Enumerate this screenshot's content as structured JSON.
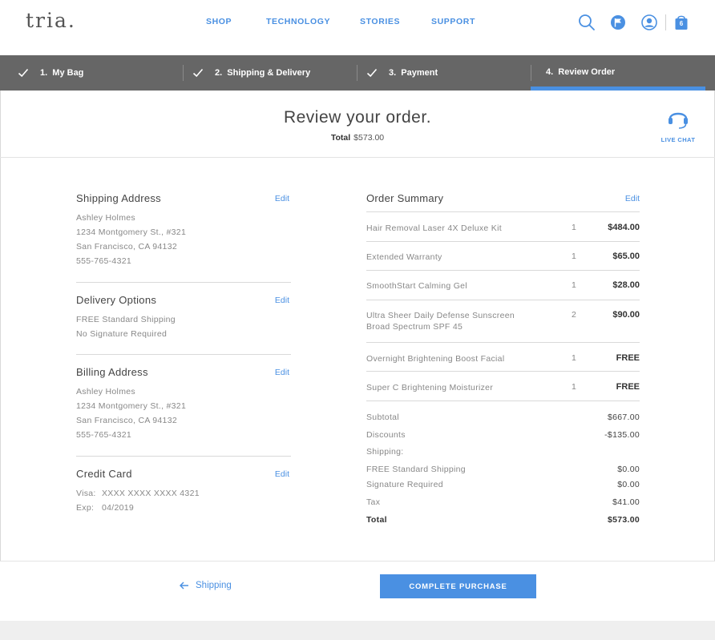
{
  "brand": {
    "logo": "tria",
    "logo_dot": "."
  },
  "nav": {
    "items": [
      "SHOP",
      "TECHNOLOGY",
      "STORIES",
      "SUPPORT"
    ]
  },
  "header": {
    "cart_count": "6"
  },
  "steps": [
    {
      "label": "1.  My Bag",
      "done": true
    },
    {
      "label": "2.  Shipping & Delivery",
      "done": true
    },
    {
      "label": "3.  Payment",
      "done": true
    },
    {
      "label": "4.  Review Order",
      "done": false,
      "active": true
    }
  ],
  "title": {
    "heading": "Review your order.",
    "total_label": "Total",
    "total_value": "$573.00"
  },
  "live_chat": {
    "label": "LIVE CHAT"
  },
  "shipping_address": {
    "title": "Shipping Address",
    "edit": "Edit",
    "lines": [
      "Ashley Holmes",
      "1234 Montgomery St., #321",
      "San Francisco, CA 94132",
      "555-765-4321"
    ]
  },
  "delivery_options": {
    "title": "Delivery Options",
    "edit": "Edit",
    "lines": [
      "FREE Standard Shipping",
      "No Signature Required"
    ]
  },
  "billing_address": {
    "title": "Billing Address",
    "edit": "Edit",
    "lines": [
      "Ashley Holmes",
      "1234 Montgomery St., #321",
      "San Francisco, CA 94132",
      "555-765-4321"
    ]
  },
  "credit_card": {
    "title": "Credit Card",
    "edit": "Edit",
    "visa_label": "Visa:",
    "visa_value": "XXXX XXXX XXXX 4321",
    "exp_label": "Exp:",
    "exp_value": "04/2019"
  },
  "order_summary": {
    "title": "Order Summary",
    "edit": "Edit",
    "items": [
      {
        "name": "Hair Removal Laser 4X Deluxe Kit",
        "qty": "1",
        "price": "$484.00"
      },
      {
        "name": "Extended Warranty",
        "qty": "1",
        "price": "$65.00"
      },
      {
        "name": "SmoothStart Calming Gel",
        "qty": "1",
        "price": "$28.00"
      },
      {
        "name": "Ultra Sheer Daily Defense Sunscreen",
        "name2": "Broad Spectrum SPF 45",
        "qty": "2",
        "price": "$90.00"
      },
      {
        "name": "Overnight Brightening Boost Facial",
        "qty": "1",
        "price": "FREE"
      },
      {
        "name": "Super C Brightening Moisturizer",
        "qty": "1",
        "price": "FREE"
      }
    ],
    "totals": [
      {
        "label": "Subtotal",
        "value": "$667.00"
      },
      {
        "label": "Discounts",
        "value": "-$135.00"
      },
      {
        "label": "Shipping:",
        "value": ""
      },
      {
        "label": "FREE Standard Shipping",
        "value": "$0.00"
      },
      {
        "label": "Signature Required",
        "value": "$0.00"
      },
      {
        "label": "Tax",
        "value": "$41.00"
      },
      {
        "label": "Total",
        "value": "$573.00"
      }
    ]
  },
  "footer": {
    "back_label": "Shipping",
    "cta_label": "COMPLETE PURCHASE"
  },
  "colors": {
    "accent": "#4a90e2",
    "steps_bg": "#666666",
    "muted_text": "#888888"
  }
}
